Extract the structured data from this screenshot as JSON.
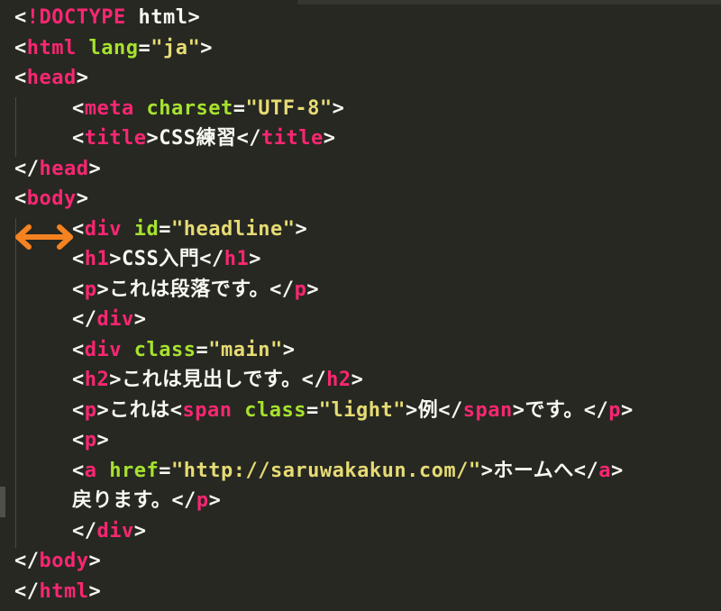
{
  "editor": {
    "lines": [
      {
        "lt": "<",
        "doctype": "!DOCTYPE",
        "sp1": " ",
        "word": "html",
        "gt": ">"
      },
      {
        "lt": "<",
        "tag": "html",
        "sp": " ",
        "attr": "lang",
        "eq": "=",
        "val": "\"ja\"",
        "gt": ">"
      },
      {
        "lt": "<",
        "tag": "head",
        "gt": ">"
      },
      {
        "lt": "<",
        "tag": "meta",
        "sp": " ",
        "attr": "charset",
        "eq": "=",
        "val": "\"UTF-8\"",
        "gt": ">"
      },
      {
        "lt1": "<",
        "tag1": "title",
        "gt1": ">",
        "text": "CSS練習",
        "lt2": "</",
        "tag2": "title",
        "gt2": ">"
      },
      {
        "lt": "</",
        "tag": "head",
        "gt": ">"
      },
      {
        "lt": "<",
        "tag": "body",
        "gt": ">"
      },
      {
        "lt": "<",
        "tag": "div",
        "sp": " ",
        "attr": "id",
        "eq": "=",
        "val": "\"headline\"",
        "gt": ">"
      },
      {
        "lt1": "<",
        "tag1": "h1",
        "gt1": ">",
        "text": "CSS入門",
        "lt2": "</",
        "tag2": "h1",
        "gt2": ">"
      },
      {
        "lt1": "<",
        "tag1": "p",
        "gt1": ">",
        "text": "これは段落です。",
        "lt2": "</",
        "tag2": "p",
        "gt2": ">"
      },
      {
        "lt": "</",
        "tag": "div",
        "gt": ">"
      },
      {
        "lt": "<",
        "tag": "div",
        "sp": " ",
        "attr": "class",
        "eq": "=",
        "val": "\"main\"",
        "gt": ">"
      },
      {
        "lt1": "<",
        "tag1": "h2",
        "gt1": ">",
        "text": "これは見出しです。",
        "lt2": "</",
        "tag2": "h2",
        "gt2": ">"
      },
      {
        "lt1": "<",
        "tag1": "p",
        "gt1": ">",
        "text1": "これは",
        "lt2": "<",
        "tag2": "span",
        "sp": " ",
        "attr": "class",
        "eq": "=",
        "val": "\"light\"",
        "gt2": ">",
        "text2": "例",
        "lt3": "</",
        "tag3": "span",
        "gt3": ">",
        "text3": "です。",
        "lt4": "</",
        "tag4": "p",
        "gt4": ">"
      },
      {
        "lt": "<",
        "tag": "p",
        "gt": ">"
      },
      {
        "lt1": "<",
        "tag1": "a",
        "sp": " ",
        "attr": "href",
        "eq": "=",
        "val": "\"http://saruwakakun.com/\"",
        "gt1": ">",
        "text": "ホームへ",
        "lt2": "</",
        "tag2": "a",
        "gt2": ">"
      },
      {
        "text": "戻ります。",
        "lt": "</",
        "tag": "p",
        "gt": ">"
      },
      {
        "lt": "</",
        "tag": "div",
        "gt": ">"
      },
      {
        "lt": "</",
        "tag": "body",
        "gt": ">"
      },
      {
        "lt": "</",
        "tag": "html",
        "gt": ">"
      }
    ]
  },
  "annotation": {
    "icon": "double-headed-arrow-icon",
    "color": "#f58220"
  },
  "colors": {
    "background": "#272822",
    "tag": "#f92672",
    "attribute": "#a6e22e",
    "string": "#e6db74",
    "text": "#f8f8f2"
  }
}
